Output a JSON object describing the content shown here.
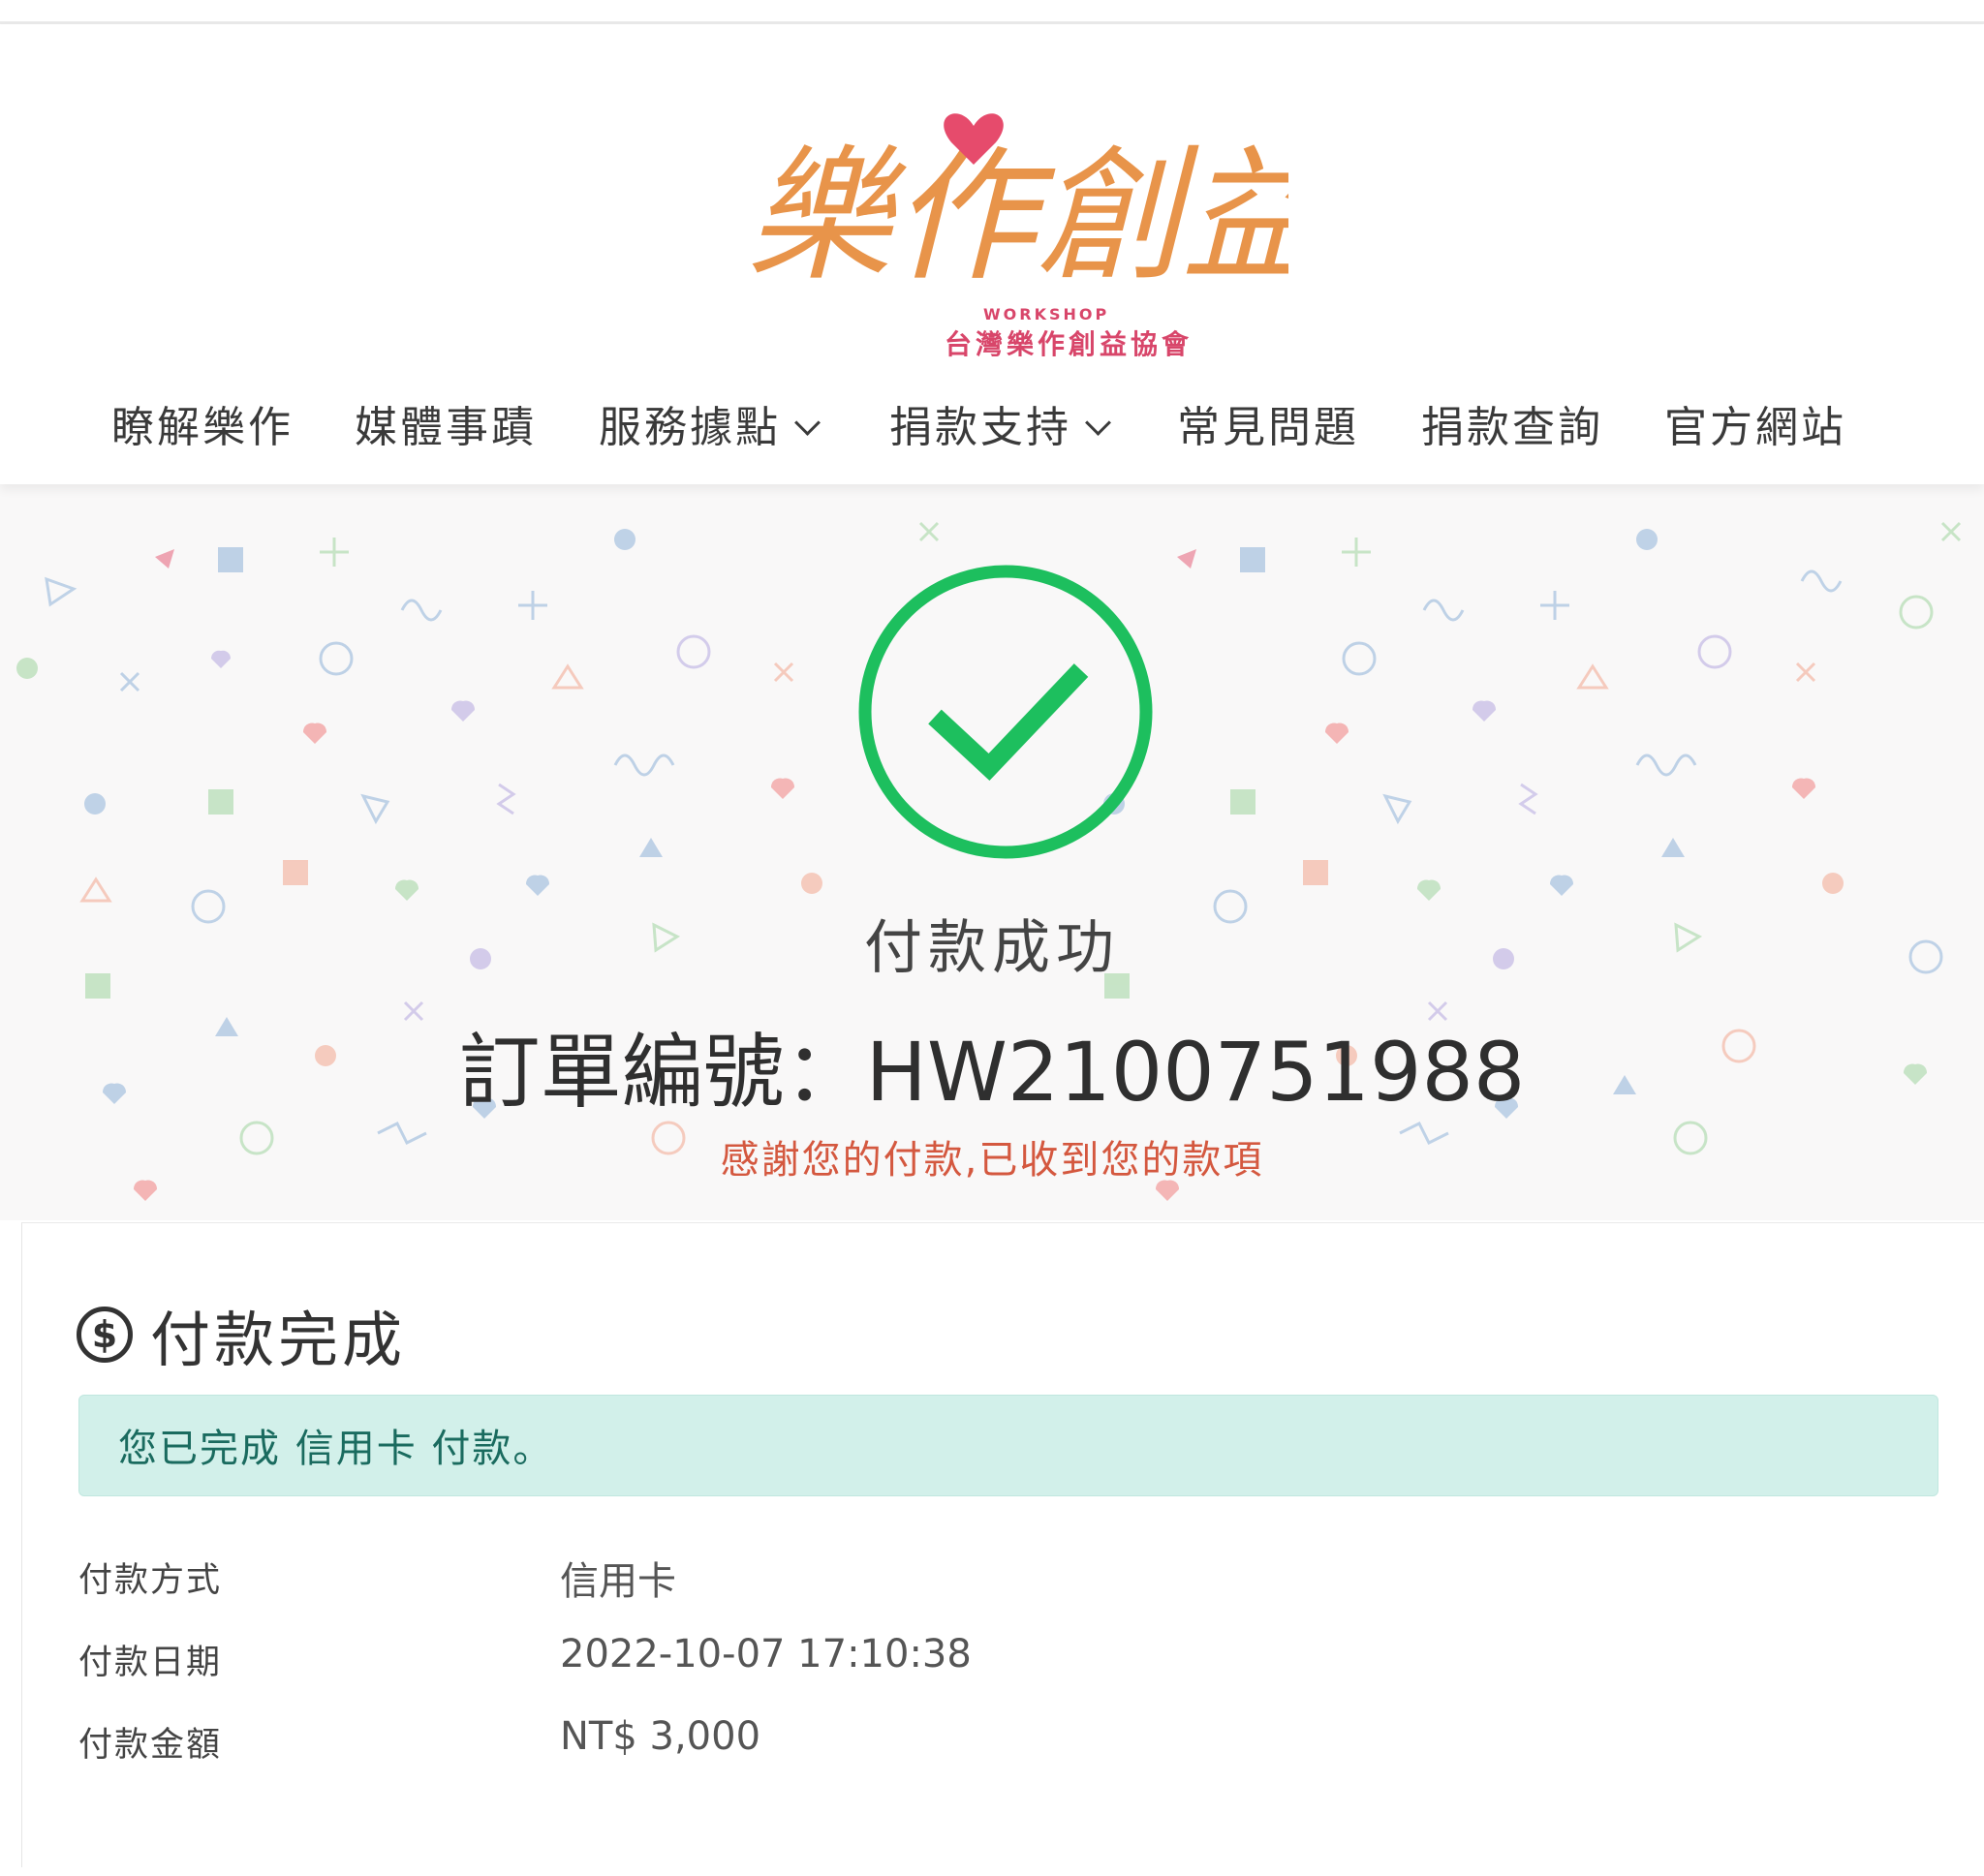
{
  "logo": {
    "text": "樂作創益",
    "subtitle_en": "WORKSHOP",
    "subtitle_zh": "台灣樂作創益協會"
  },
  "nav": {
    "items": [
      {
        "label": "瞭解樂作",
        "has_dropdown": false
      },
      {
        "label": "媒體事蹟",
        "has_dropdown": false
      },
      {
        "label": "服務據點",
        "has_dropdown": true
      },
      {
        "label": "捐款支持",
        "has_dropdown": true
      },
      {
        "label": "常見問題",
        "has_dropdown": false
      },
      {
        "label": "捐款查詢",
        "has_dropdown": false
      },
      {
        "label": "官方網站",
        "has_dropdown": false
      }
    ]
  },
  "hero": {
    "status_icon": "check-circle-icon",
    "status_title": "付款成功",
    "order_line": "訂單編號：HW2100751988",
    "thanks_message": "感謝您的付款,已收到您的款項"
  },
  "card": {
    "icon": "dollar-circle-icon",
    "title": "付款完成",
    "alert_text": "您已完成 信用卡 付款。",
    "rows": [
      {
        "label": "付款方式",
        "value": "信用卡"
      },
      {
        "label": "付款日期",
        "value": "2022-10-07 17:10:38"
      },
      {
        "label": "付款金額",
        "value": "NT$ 3,000"
      }
    ]
  },
  "colors": {
    "success_green": "#1dbf5e",
    "thanks_red": "#d4583f",
    "alert_bg": "#d2f0ea",
    "alert_text": "#1a6b5f",
    "logo_orange": "#e8944a",
    "logo_heart": "#e64b6c"
  }
}
